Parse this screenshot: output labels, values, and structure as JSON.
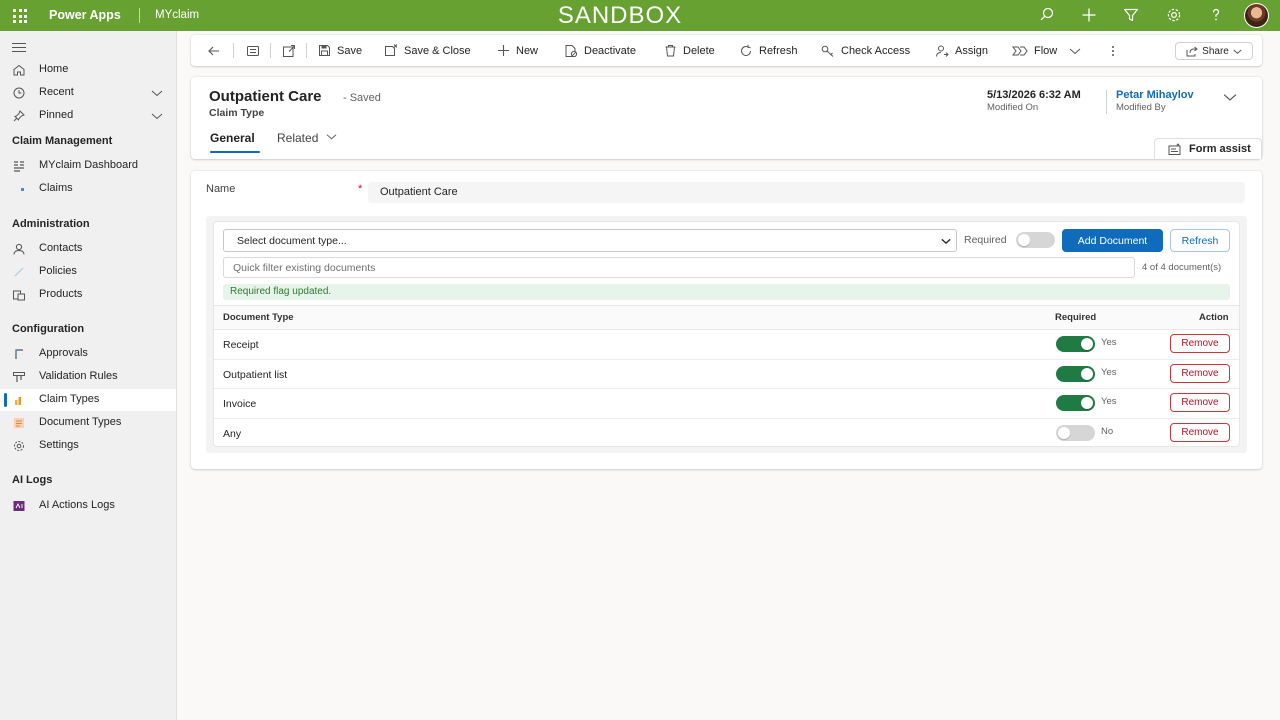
{
  "topbar": {
    "app_name": "Power Apps",
    "env_name": "MYclaim",
    "banner": "SANDBOX",
    "icons": [
      "waffle-icon",
      "search-icon",
      "plus-icon",
      "filter-icon",
      "gear-icon",
      "help-icon",
      "avatar"
    ],
    "color": "#66a132"
  },
  "nav": {
    "items": [
      {
        "label": "Home",
        "icon": "home-icon"
      },
      {
        "label": "Recent",
        "icon": "clock-icon"
      },
      {
        "label": "Pinned",
        "icon": "pin-icon"
      }
    ],
    "sections": [
      {
        "title": "Claim Management",
        "items": [
          {
            "label": "MYclaim Dashboard",
            "icon": "dashboard-icon"
          },
          {
            "label": "Claims",
            "icon": "dot-icon"
          }
        ]
      },
      {
        "title": "Administration",
        "items": [
          {
            "label": "Contacts",
            "icon": "person-icon"
          },
          {
            "label": "Policies",
            "icon": "policy-icon"
          },
          {
            "label": "Products",
            "icon": "products-icon"
          }
        ]
      },
      {
        "title": "Configuration",
        "items": [
          {
            "label": "Approvals",
            "icon": "approvals-icon"
          },
          {
            "label": "Validation Rules",
            "icon": "rules-icon"
          },
          {
            "label": "Claim Types",
            "icon": "claim-types-icon",
            "selected": true
          },
          {
            "label": "Document Types",
            "icon": "document-types-icon"
          },
          {
            "label": "Settings",
            "icon": "gear-icon"
          }
        ]
      },
      {
        "title": "AI Logs",
        "items": [
          {
            "label": "AI Actions Logs",
            "icon": "ai-logs-icon"
          }
        ]
      }
    ]
  },
  "commandbar": {
    "save": "Save",
    "save_close": "Save & Close",
    "new": "New",
    "deactivate": "Deactivate",
    "delete": "Delete",
    "refresh": "Refresh",
    "check_access": "Check Access",
    "assign": "Assign",
    "flow": "Flow",
    "share": "Share"
  },
  "header": {
    "title": "Outpatient Care",
    "saved_status": "- Saved",
    "entity": "Claim Type",
    "modified_on_value": "5/13/2026 6:32 AM",
    "modified_on_label": "Modified On",
    "modified_by_value": "Petar Mihaylov",
    "modified_by_label": "Modified By",
    "tabs": [
      "General",
      "Related"
    ],
    "form_assist": "Form assist"
  },
  "form": {
    "name_label": "Name",
    "name_required_mark": "*",
    "name_value": "Outpatient Care"
  },
  "documents": {
    "select_placeholder": "Select document type...",
    "required_label": "Required",
    "required_toggle_on": false,
    "add_button": "Add Document",
    "refresh_button": "Refresh",
    "filter_placeholder": "Quick filter existing documents",
    "count_text": "4 of 4 document(s)",
    "status_message": "Required flag updated.",
    "columns": [
      "Document Type",
      "Required",
      "Action"
    ],
    "rows": [
      {
        "type": "Receipt",
        "required": true,
        "required_text": "Yes",
        "action": "Remove"
      },
      {
        "type": "Outpatient list",
        "required": true,
        "required_text": "Yes",
        "action": "Remove"
      },
      {
        "type": "Invoice",
        "required": true,
        "required_text": "Yes",
        "action": "Remove"
      },
      {
        "type": "Any",
        "required": false,
        "required_text": "No",
        "action": "Remove"
      }
    ],
    "colors": {
      "accent": "#0f6cbd",
      "toggle_on": "#1f7a44",
      "remove": "#c50f1f"
    }
  }
}
